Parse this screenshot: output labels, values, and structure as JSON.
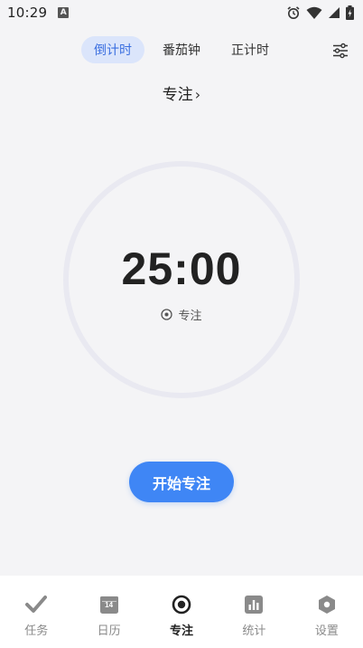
{
  "status_bar": {
    "time": "10:29",
    "notification_letter": "A"
  },
  "mode_tabs": [
    {
      "label": "倒计时",
      "active": true
    },
    {
      "label": "番茄钟",
      "active": false
    },
    {
      "label": "正计时",
      "active": false
    }
  ],
  "focus": {
    "label": "专注",
    "chevron": "›"
  },
  "timer": {
    "display": "25:00",
    "tag_label": "专注"
  },
  "start_button": {
    "label": "开始专注"
  },
  "bottom_nav": [
    {
      "label": "任务",
      "icon": "check-icon",
      "active": false
    },
    {
      "label": "日历",
      "icon": "calendar-icon",
      "calendar_day": "14",
      "active": false
    },
    {
      "label": "专注",
      "icon": "focus-target-icon",
      "active": true
    },
    {
      "label": "统计",
      "icon": "chart-icon",
      "active": false
    },
    {
      "label": "设置",
      "icon": "hexagon-settings-icon",
      "active": false
    }
  ],
  "colors": {
    "accent": "#3f86f5",
    "tab_active_bg": "#dbe5fb",
    "tab_active_text": "#3b6fe0",
    "background": "#f4f4f6",
    "ring": "#e9e9f1",
    "nav_inactive": "#8a8a8a"
  }
}
